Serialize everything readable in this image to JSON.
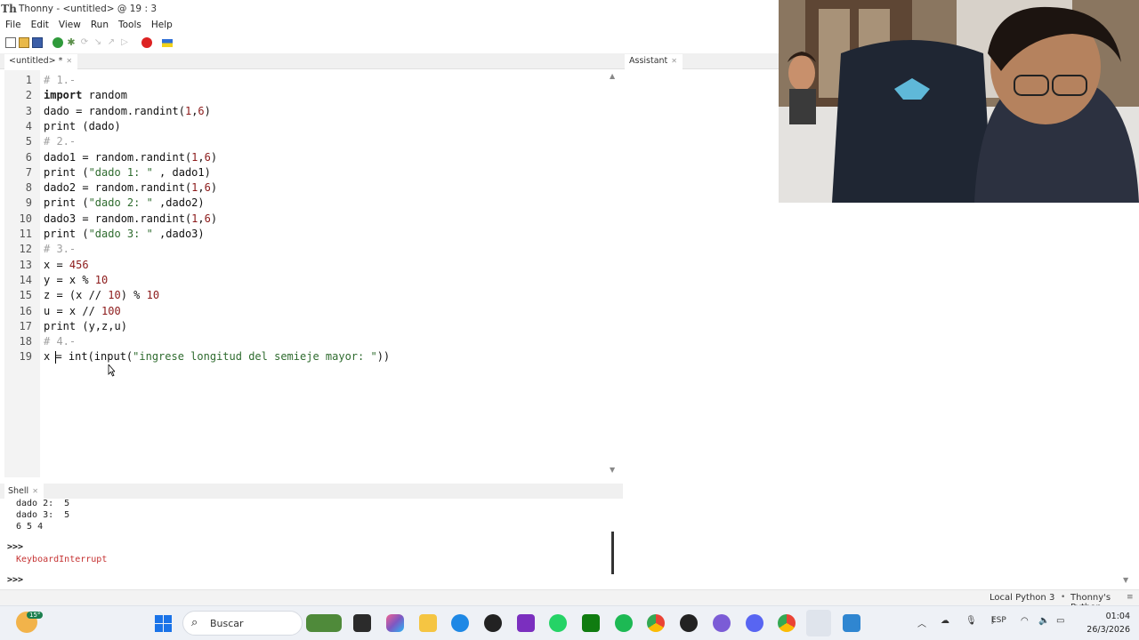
{
  "window": {
    "title": "Thonny  -  <untitled>  @  19 : 3"
  },
  "menu": [
    "File",
    "Edit",
    "View",
    "Run",
    "Tools",
    "Help"
  ],
  "editor": {
    "tab_label": "<untitled> *",
    "lines": [
      {
        "n": "1",
        "parts": [
          {
            "c": "comment",
            "t": "# 1.-"
          }
        ]
      },
      {
        "n": "2",
        "parts": [
          {
            "c": "kw",
            "t": "import"
          },
          {
            "c": "",
            "t": " random"
          }
        ]
      },
      {
        "n": "3",
        "parts": [
          {
            "c": "",
            "t": "dado = random.randint("
          },
          {
            "c": "num",
            "t": "1"
          },
          {
            "c": "",
            "t": ","
          },
          {
            "c": "num",
            "t": "6"
          },
          {
            "c": "",
            "t": ")"
          }
        ]
      },
      {
        "n": "4",
        "parts": [
          {
            "c": "",
            "t": "print (dado)"
          }
        ]
      },
      {
        "n": "5",
        "parts": [
          {
            "c": "comment",
            "t": "# 2.-"
          }
        ]
      },
      {
        "n": "6",
        "parts": [
          {
            "c": "",
            "t": "dado1 = random.randint("
          },
          {
            "c": "num",
            "t": "1"
          },
          {
            "c": "",
            "t": ","
          },
          {
            "c": "num",
            "t": "6"
          },
          {
            "c": "",
            "t": ")"
          }
        ]
      },
      {
        "n": "7",
        "parts": [
          {
            "c": "",
            "t": "print ("
          },
          {
            "c": "str",
            "t": "\"dado 1: \""
          },
          {
            "c": "",
            "t": " , dado1)"
          }
        ]
      },
      {
        "n": "8",
        "parts": [
          {
            "c": "",
            "t": "dado2 = random.randint("
          },
          {
            "c": "num",
            "t": "1"
          },
          {
            "c": "",
            "t": ","
          },
          {
            "c": "num",
            "t": "6"
          },
          {
            "c": "",
            "t": ")"
          }
        ]
      },
      {
        "n": "9",
        "parts": [
          {
            "c": "",
            "t": "print ("
          },
          {
            "c": "str",
            "t": "\"dado 2: \""
          },
          {
            "c": "",
            "t": " ,dado2)"
          }
        ]
      },
      {
        "n": "10",
        "parts": [
          {
            "c": "",
            "t": "dado3 = random.randint("
          },
          {
            "c": "num",
            "t": "1"
          },
          {
            "c": "",
            "t": ","
          },
          {
            "c": "num",
            "t": "6"
          },
          {
            "c": "",
            "t": ")"
          }
        ]
      },
      {
        "n": "11",
        "parts": [
          {
            "c": "",
            "t": "print ("
          },
          {
            "c": "str",
            "t": "\"dado 3: \""
          },
          {
            "c": "",
            "t": " ,dado3)"
          }
        ]
      },
      {
        "n": "12",
        "parts": [
          {
            "c": "comment",
            "t": "# 3.-"
          }
        ]
      },
      {
        "n": "13",
        "parts": [
          {
            "c": "",
            "t": "x = "
          },
          {
            "c": "num",
            "t": "456"
          }
        ]
      },
      {
        "n": "14",
        "parts": [
          {
            "c": "",
            "t": "y = x % "
          },
          {
            "c": "num",
            "t": "10"
          }
        ]
      },
      {
        "n": "15",
        "parts": [
          {
            "c": "",
            "t": "z = (x // "
          },
          {
            "c": "num",
            "t": "10"
          },
          {
            "c": "",
            "t": ") % "
          },
          {
            "c": "num",
            "t": "10"
          }
        ]
      },
      {
        "n": "16",
        "parts": [
          {
            "c": "",
            "t": "u = x // "
          },
          {
            "c": "num",
            "t": "100"
          }
        ]
      },
      {
        "n": "17",
        "parts": [
          {
            "c": "",
            "t": "print (y,z,u)"
          }
        ]
      },
      {
        "n": "18",
        "parts": [
          {
            "c": "comment",
            "t": "# 4.-"
          }
        ]
      },
      {
        "n": "19",
        "parts": [
          {
            "c": "",
            "t": "x "
          },
          {
            "c": "caret",
            "t": ""
          },
          {
            "c": "",
            "t": "= int(input("
          },
          {
            "c": "str",
            "t": "\"ingrese longitud del semieje mayor: \""
          },
          {
            "c": "",
            "t": "))"
          }
        ]
      }
    ]
  },
  "assistant": {
    "tab_label": "Assistant"
  },
  "shell": {
    "tab_label": "Shell",
    "output": [
      "dado 2:  5",
      "dado 3:  5",
      "6 5 4"
    ],
    "prompt": ">>>",
    "error": "KeyboardInterrupt",
    "prompt2": ">>>"
  },
  "statusbar": {
    "interpreter": "Local Python 3",
    "backend": "Thonny's Python"
  },
  "taskbar": {
    "weather_temp": "15°",
    "search_label": "Buscar",
    "language": "ESP",
    "time": "01:04",
    "date": "26/3/2026"
  },
  "colors": {
    "comment": "#a0a0a0",
    "number": "#8c1a1a",
    "string": "#2e6b2e",
    "error": "#c53232",
    "taskbar": "#eef1f6"
  }
}
